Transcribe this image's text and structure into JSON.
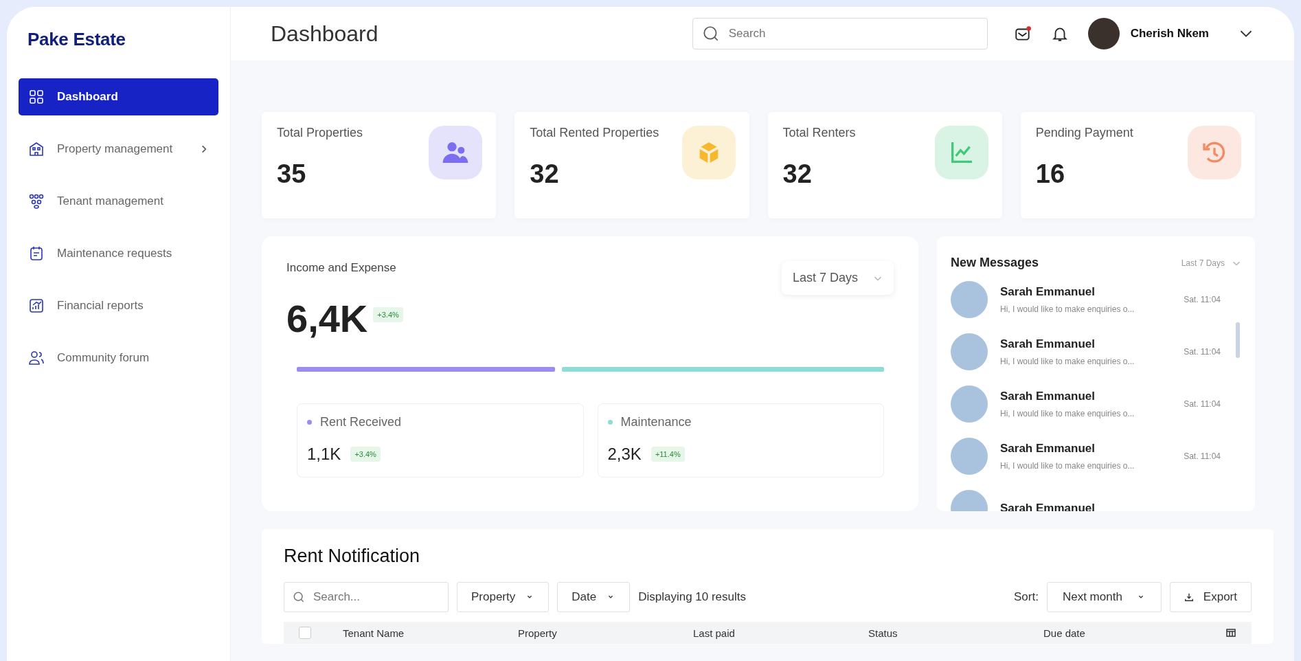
{
  "brand": "Pake Estate",
  "sidebar": {
    "items": [
      {
        "label": "Dashboard",
        "kind": "grid",
        "selected": true,
        "has_submenu": false
      },
      {
        "label": "Property management",
        "kind": "building",
        "selected": false,
        "has_submenu": true
      },
      {
        "label": "Tenant management",
        "kind": "people",
        "selected": false,
        "has_submenu": false
      },
      {
        "label": "Maintenance requests",
        "kind": "calendar",
        "selected": false,
        "has_submenu": false
      },
      {
        "label": "Financial reports",
        "kind": "report",
        "selected": false,
        "has_submenu": false
      },
      {
        "label": "Community forum",
        "kind": "users",
        "selected": false,
        "has_submenu": false
      }
    ]
  },
  "header": {
    "title": "Dashboard",
    "search": {
      "placeholder": "Search"
    },
    "mail_unread": true,
    "user": {
      "name": "Cherish Nkem"
    }
  },
  "stats": [
    {
      "label": "Total Properties",
      "value": "35",
      "kind": "people",
      "color": "#7b6ef0"
    },
    {
      "label": "Total Rented Properties",
      "value": "32",
      "kind": "boxes",
      "color": "#f5b82e"
    },
    {
      "label": "Total Renters",
      "value": "32",
      "kind": "chart",
      "color": "#3fca7a"
    },
    {
      "label": "Pending Payment",
      "value": "16",
      "kind": "history",
      "color": "#f28a62"
    }
  ],
  "income": {
    "title": "Income and Expense",
    "period": "Last 7 Days",
    "total": "6,4K",
    "change": "+3.4%",
    "level": 0.44,
    "parts": [
      {
        "label": "Rent Received",
        "value": "1,1K",
        "change": "+3.4%",
        "color": "#9b8cf0"
      },
      {
        "label": "Maintenance",
        "value": "2,3K",
        "change": "+11.4%",
        "color": "#8fdcd6"
      }
    ]
  },
  "messages": {
    "title": "New Messages",
    "period": "Last 7 Days",
    "items": [
      {
        "name": "Sarah Emmanuel",
        "text": "Hi, I would like to make enquiries o...",
        "time": "Sat. 11:04"
      },
      {
        "name": "Sarah Emmanuel",
        "text": "Hi, I would like to make enquiries o...",
        "time": "Sat. 11:04"
      },
      {
        "name": "Sarah Emmanuel",
        "text": "Hi, I would like to make enquiries o...",
        "time": "Sat. 11:04"
      },
      {
        "name": "Sarah Emmanuel",
        "text": "Hi, I would like to make enquiries o...",
        "time": "Sat. 11:04"
      },
      {
        "name": "Sarah Emmanuel"
      }
    ]
  },
  "rent": {
    "title": "Rent Notification",
    "search": {
      "placeholder": "Search..."
    },
    "filters": [
      "Property",
      "Date"
    ],
    "result_text": "Displaying 10 results",
    "sort_label": "Sort:",
    "sort_value": "Next month",
    "export": "Export",
    "table": {
      "select_all_checked": false,
      "columns": [
        "Tenant Name",
        "Property",
        "Last paid",
        "Status",
        "Due date"
      ]
    }
  }
}
